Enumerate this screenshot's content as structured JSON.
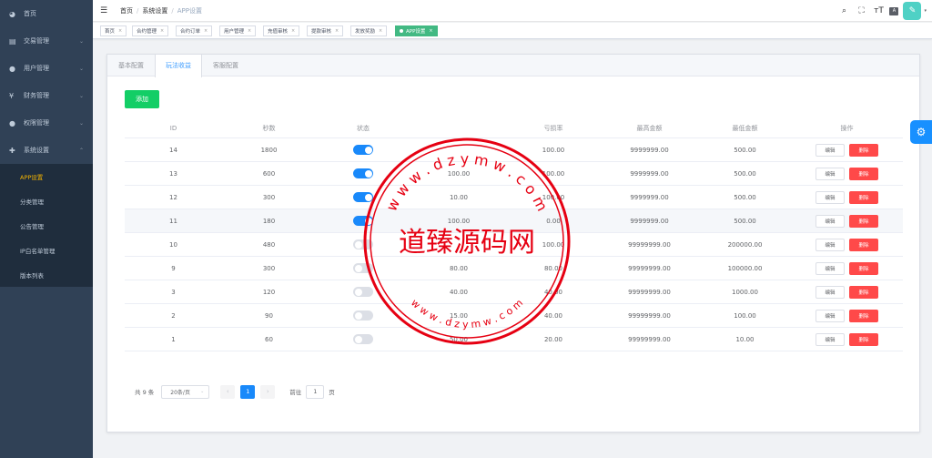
{
  "sidebar": {
    "items": [
      {
        "label": "首页",
        "icon": "dashboard-icon",
        "arrow": ""
      },
      {
        "label": "交易管理",
        "icon": "wallet-icon",
        "arrow": "⌄"
      },
      {
        "label": "用户管理",
        "icon": "user-icon",
        "arrow": "⌄"
      },
      {
        "label": "财务管理",
        "icon": "yen-icon",
        "arrow": "⌄"
      },
      {
        "label": "权限管理",
        "icon": "lock-user-icon",
        "arrow": "⌄"
      },
      {
        "label": "系统设置",
        "icon": "plus-cross-icon",
        "arrow": "⌃"
      }
    ],
    "submenu": [
      "APP设置",
      "分类管理",
      "公告管理",
      "IP白名单管理",
      "版本列表"
    ]
  },
  "topbar": {
    "breadcrumb": [
      "首页",
      "系统设置",
      "APP设置"
    ],
    "sep": "/",
    "avatar_glyph": "✎",
    "avatar_caret": "▾"
  },
  "tags": [
    {
      "label": "首页",
      "close": "×"
    },
    {
      "label": "合约管理",
      "close": "×"
    },
    {
      "label": "合约订单",
      "close": "×"
    },
    {
      "label": "用户管理",
      "close": "×"
    },
    {
      "label": "充值审核",
      "close": "×"
    },
    {
      "label": "提款审核",
      "close": "×"
    },
    {
      "label": "发放奖励",
      "close": "×"
    },
    {
      "label": "APP设置",
      "close": "×"
    }
  ],
  "tabs": [
    "基本配置",
    "玩法收益",
    "客服配置"
  ],
  "add_label": "添加",
  "table": {
    "headers": [
      "ID",
      "秒数",
      "状态",
      "",
      "亏损率",
      "最高金额",
      "最低金额",
      "操作"
    ],
    "edit_label": "编辑",
    "delete_label": "删除",
    "rows": [
      {
        "id": "14",
        "seconds": "1800",
        "on": true,
        "rate": "",
        "loss": "100.00",
        "max": "9999999.00",
        "min": "500.00"
      },
      {
        "id": "13",
        "seconds": "600",
        "on": true,
        "rate": "100.00",
        "loss": "100.00",
        "max": "9999999.00",
        "min": "500.00"
      },
      {
        "id": "12",
        "seconds": "300",
        "on": true,
        "rate": "10.00",
        "loss": "100.00",
        "max": "9999999.00",
        "min": "500.00"
      },
      {
        "id": "11",
        "seconds": "180",
        "on": true,
        "rate": "100.00",
        "loss": "0.00",
        "max": "9999999.00",
        "min": "500.00"
      },
      {
        "id": "10",
        "seconds": "480",
        "on": false,
        "rate": "",
        "loss": "100.00",
        "max": "99999999.00",
        "min": "200000.00"
      },
      {
        "id": "9",
        "seconds": "300",
        "on": false,
        "rate": "80.00",
        "loss": "80.00",
        "max": "99999999.00",
        "min": "100000.00"
      },
      {
        "id": "3",
        "seconds": "120",
        "on": false,
        "rate": "40.00",
        "loss": "40.00",
        "max": "99999999.00",
        "min": "1000.00"
      },
      {
        "id": "2",
        "seconds": "90",
        "on": false,
        "rate": "15.00",
        "loss": "40.00",
        "max": "99999999.00",
        "min": "100.00"
      },
      {
        "id": "1",
        "seconds": "60",
        "on": false,
        "rate": "50.00",
        "loss": "20.00",
        "max": "99999999.00",
        "min": "10.00"
      }
    ]
  },
  "pagination": {
    "total": "共 9 条",
    "page_size": "20条/页",
    "size_caret": "⌄",
    "prev": "‹",
    "current": "1",
    "next": "›",
    "goto": "前往",
    "goto_value": "1",
    "page_unit": "页"
  },
  "watermark": {
    "center_text": "道臻源码网",
    "ring_text": "w w w . d z y m w . c o m",
    "color": "#e60012"
  }
}
